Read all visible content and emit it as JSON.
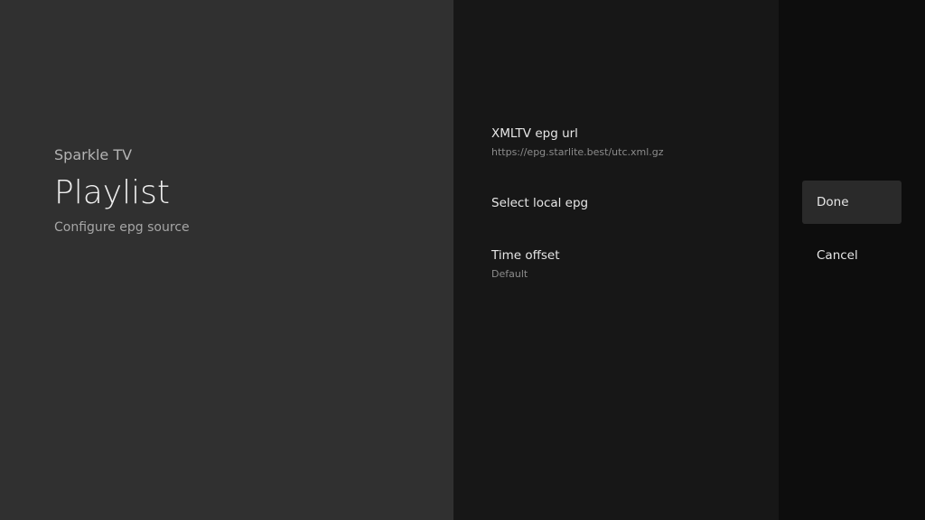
{
  "guidance": {
    "breadcrumb": "Sparkle TV",
    "title": "Playlist",
    "description": "Configure epg source"
  },
  "actions": [
    {
      "title": "XMLTV epg url",
      "description": "https://epg.starlite.best/utc.xml.gz"
    },
    {
      "title": "Select local epg",
      "description": ""
    },
    {
      "title": "Time offset",
      "description": "Default"
    }
  ],
  "buttons": {
    "done_label": "Done",
    "cancel_label": "Cancel"
  }
}
